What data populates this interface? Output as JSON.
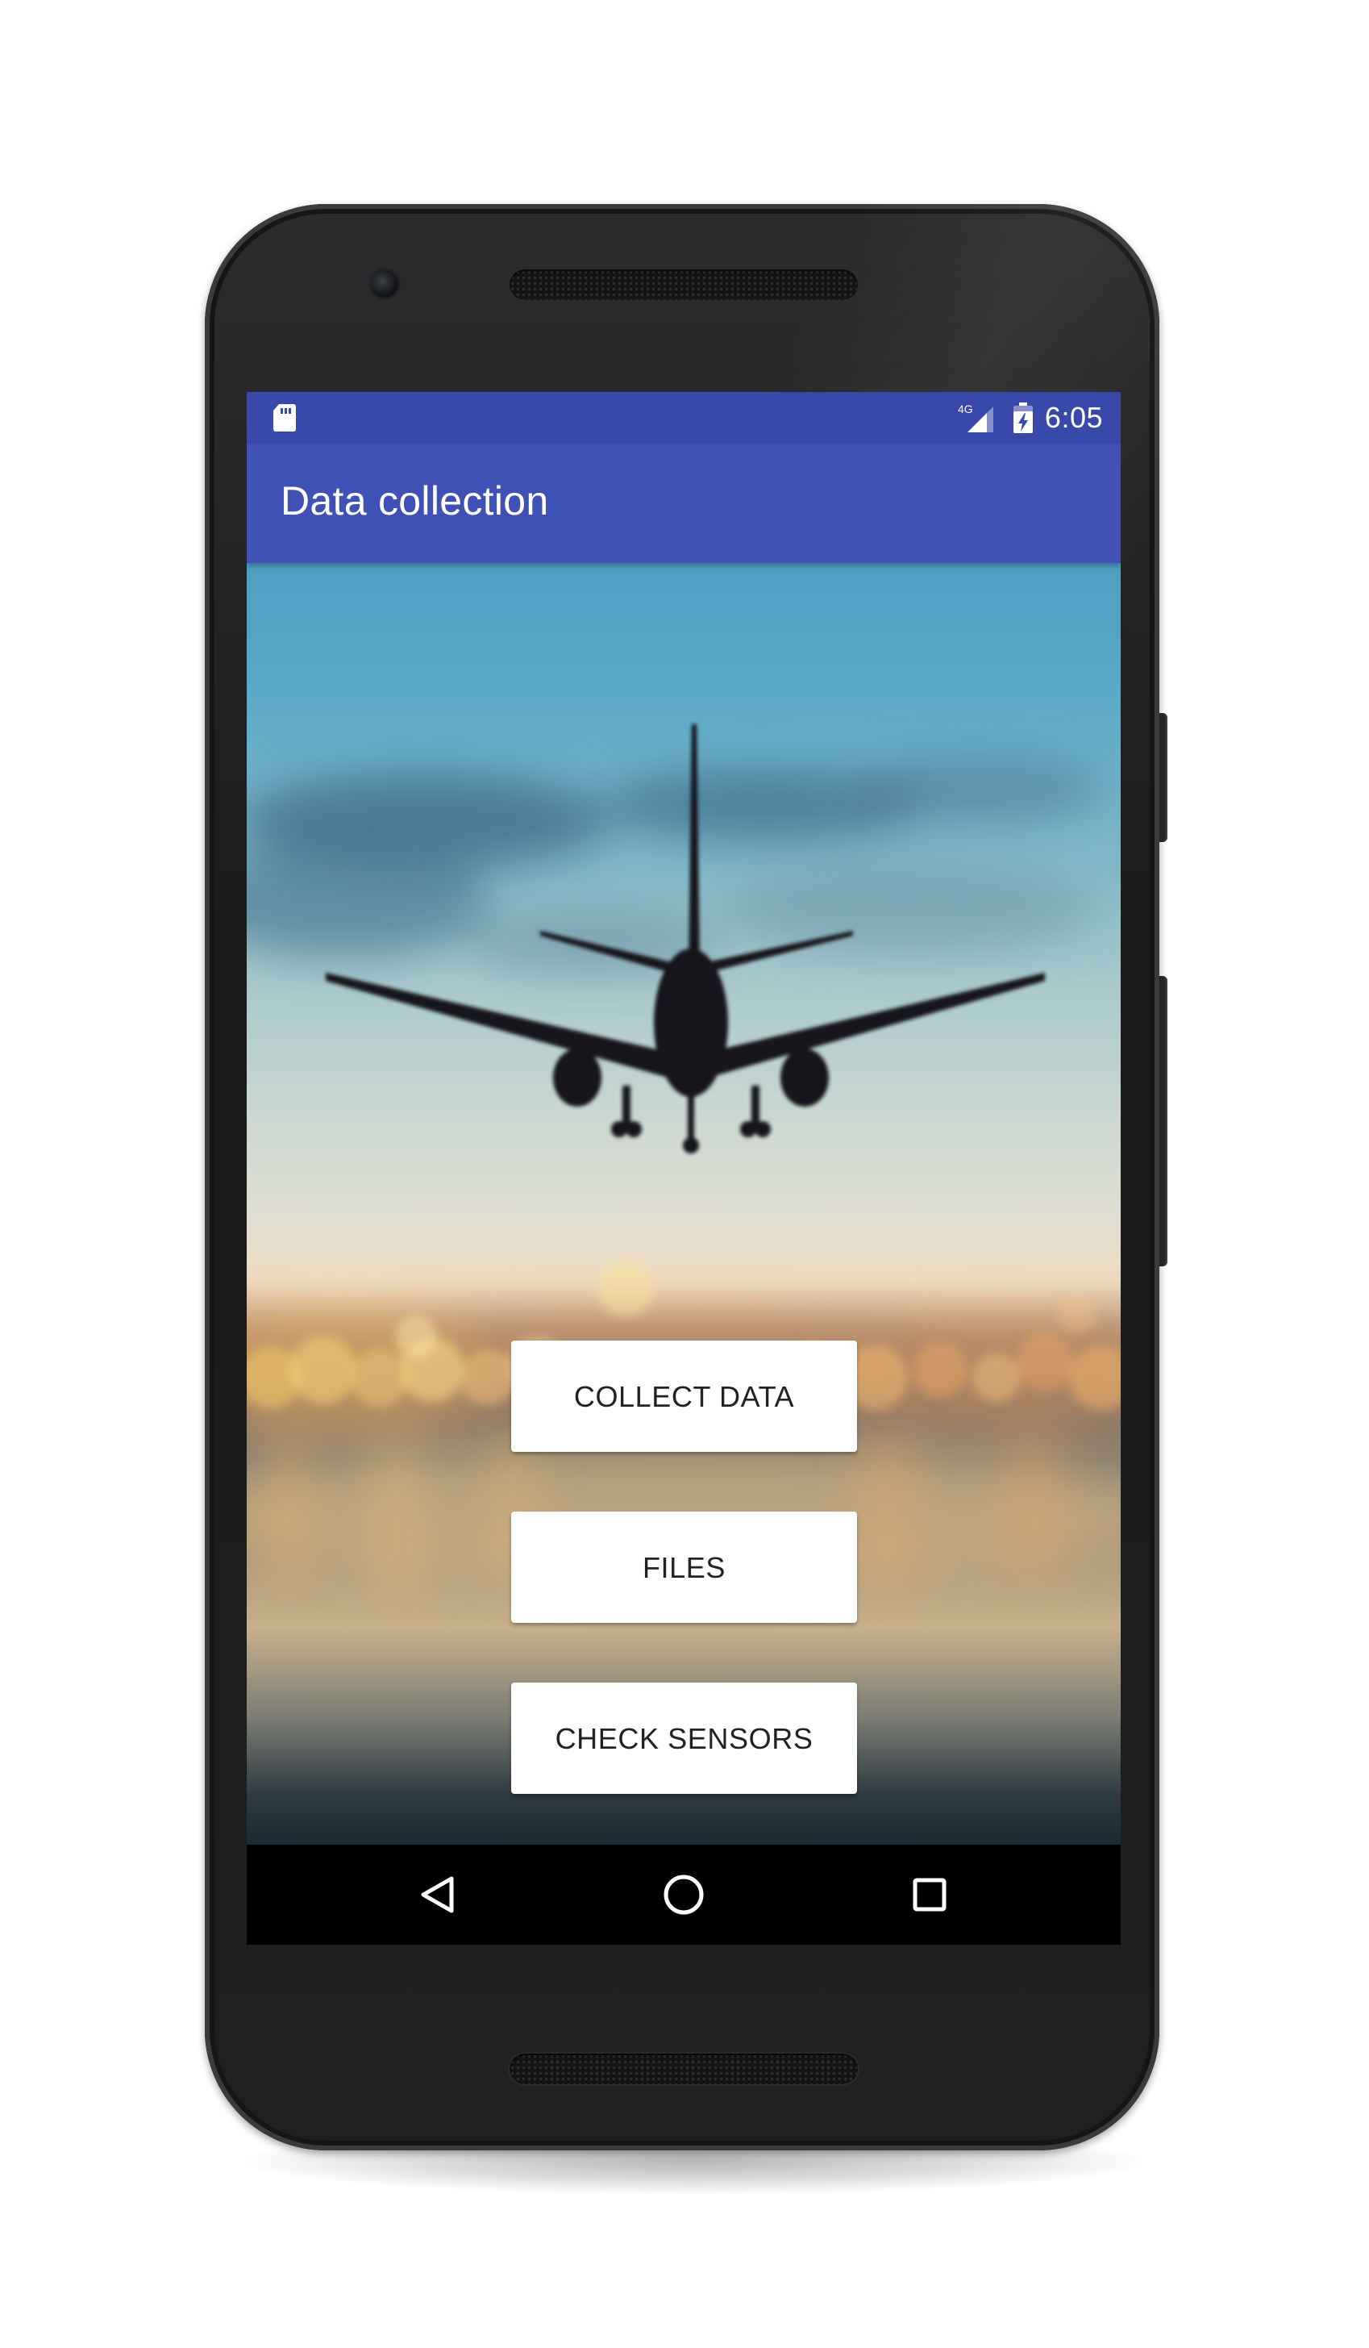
{
  "status_bar": {
    "network": "4G",
    "time": "6:05"
  },
  "app_bar": {
    "title": "Data collection"
  },
  "actions": {
    "collect_data": "COLLECT DATA",
    "files": "FILES",
    "check_sensors": "CHECK SENSORS"
  },
  "nav_bar": {
    "back_icon": "back-triangle-icon",
    "home_icon": "home-circle-icon",
    "recents_icon": "recents-square-icon"
  },
  "colors": {
    "status_bar": "#3949ab",
    "app_bar": "#3f51b5",
    "button_background": "#ffffff",
    "button_text": "#222222",
    "nav_bar": "#000000"
  }
}
